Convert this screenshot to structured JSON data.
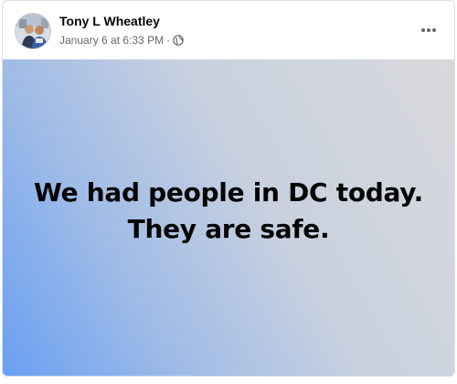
{
  "post": {
    "author": "Tony L Wheatley",
    "date": "January 6 at 6:33 PM",
    "separator": "·",
    "privacy_icon": "globe-icon",
    "menu_icon": "more-options-icon",
    "text_lines": [
      "We had people in DC today.",
      "They are safe."
    ]
  },
  "colors": {
    "background_gradient_start": "#6a9ff2",
    "background_gradient_end": "#d9d9dc",
    "author_text": "#050505",
    "meta_text": "#65676b"
  }
}
